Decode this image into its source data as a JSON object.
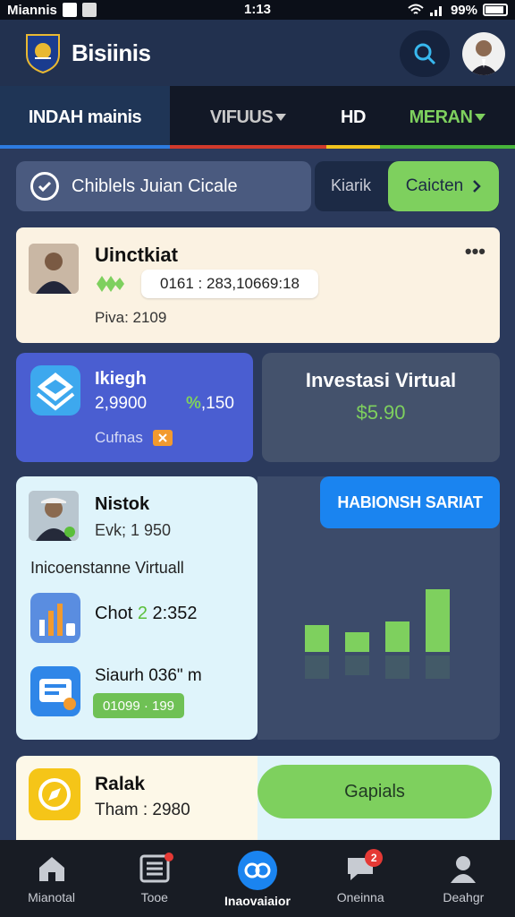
{
  "status_bar": {
    "carrier": "Miannis",
    "time": "1:13",
    "battery": "99%"
  },
  "header": {
    "brand": "Bisiinis"
  },
  "tabs": [
    {
      "label": "INDAH mainis",
      "accent": "#2d7be0"
    },
    {
      "label": "VIFUUS",
      "accent": "#d13a2c"
    },
    {
      "label": "HD",
      "accent": "#f2c31d"
    },
    {
      "label": "MERAN",
      "accent": "#47b53a"
    }
  ],
  "filter": {
    "label": "Chiblels Juian Cicale",
    "secondary": "Kiarik",
    "button": "Caicten"
  },
  "card1": {
    "name": "Uinctkiat",
    "code": "0161 : 283,10669:18",
    "sub": "Piva: 2109"
  },
  "blue_card": {
    "title": "Ikiegh",
    "value_left": "2,9900",
    "value_right_prefix": "%",
    "value_right": ",150",
    "sub": "Cufnas"
  },
  "invest_card": {
    "title": "Investasi Virtual",
    "value": "$5.90"
  },
  "big_card": {
    "name": "Nistok",
    "sub": "Evk; 1 950",
    "section": "Inicoenstanne Virtuall",
    "row1_label": "Chot ",
    "row1_accent": "2",
    "row1_value": " 2:352",
    "row2_label": "Siaurh 036\" m",
    "pill": "01099 · 199"
  },
  "chart_button": "HABIONSH SARIAT",
  "chart_data": {
    "type": "bar",
    "categories": [
      "",
      "",
      "",
      ""
    ],
    "values": [
      3,
      2.2,
      3.4,
      7
    ],
    "title": "",
    "xlabel": "",
    "ylabel": "",
    "ylim": [
      0,
      8
    ],
    "color": "#7ed05e"
  },
  "card3": {
    "title": "Ralak",
    "sub": "Tham : 2980",
    "button": "Gapials"
  },
  "nav": [
    {
      "label": "Mianotal",
      "icon": "home-icon"
    },
    {
      "label": "Tooe",
      "icon": "list-icon",
      "dot": true
    },
    {
      "label": "Inaovaiaior",
      "icon": "handshake-icon",
      "active": true
    },
    {
      "label": "Oneinna",
      "icon": "chat-icon",
      "badge": "2"
    },
    {
      "label": "Deahgr",
      "icon": "person-icon"
    }
  ]
}
